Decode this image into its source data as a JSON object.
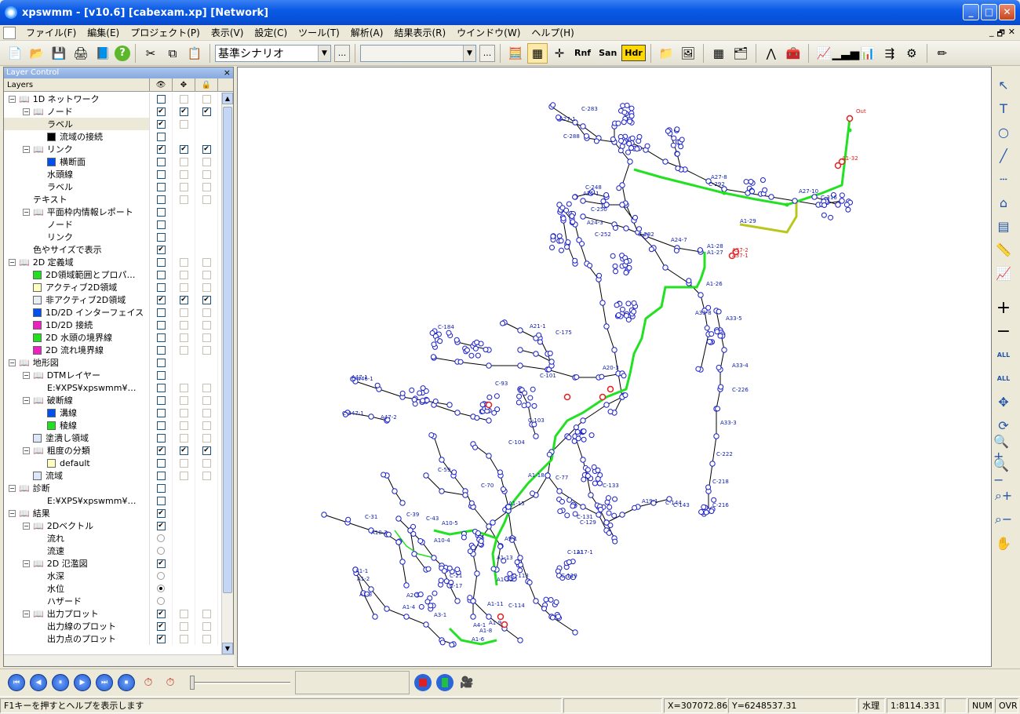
{
  "window": {
    "title": "xpswmm - [v10.6] [cabexam.xp] [Network]",
    "minimize": "_",
    "maximize": "□",
    "close": "✕"
  },
  "menu": [
    "ファイル(F)",
    "編集(E)",
    "プロジェクト(P)",
    "表示(V)",
    "設定(C)",
    "ツール(T)",
    "解析(A)",
    "結果表示(R)",
    "ウインドウ(W)",
    "ヘルプ(H)"
  ],
  "mdi_controls": [
    "_",
    "🗗",
    "✕"
  ],
  "toolbar": {
    "scenario_value": "基準シナリオ",
    "scenario_dots": "...",
    "combo2_value": "",
    "combo2_dots": "...",
    "rnf_label": "Rnf",
    "san_label": "San",
    "hdr_label": "Hdr"
  },
  "layer_panel": {
    "title": "Layer Control",
    "close": "×",
    "header_name": "Layers",
    "col_icons": [
      "👁",
      "✥",
      "🔒"
    ],
    "rows": [
      {
        "label": "1D ネットワーク",
        "level": 0,
        "exp": "−",
        "book": true,
        "c": [
          "e",
          "e",
          "e"
        ]
      },
      {
        "label": "ノード",
        "level": 1,
        "exp": "−",
        "book": true,
        "c": [
          "x",
          "x",
          "x"
        ]
      },
      {
        "label": "ラベル",
        "level": 2,
        "c": [
          "x",
          "e",
          ""
        ],
        "sel": true
      },
      {
        "label": "流域の接続",
        "level": 2,
        "sw": "#000000",
        "c": [
          "e",
          "",
          ""
        ]
      },
      {
        "label": "リンク",
        "level": 1,
        "exp": "−",
        "book": true,
        "c": [
          "x",
          "x",
          "x"
        ]
      },
      {
        "label": "横断面",
        "level": 2,
        "sw": "#0050f0",
        "c": [
          "e",
          "e",
          "e"
        ]
      },
      {
        "label": "水頭線",
        "level": 2,
        "c": [
          "e",
          "e",
          "e"
        ]
      },
      {
        "label": "ラベル",
        "level": 2,
        "c": [
          "e",
          "e",
          "e"
        ]
      },
      {
        "label": "テキスト",
        "level": 1,
        "c": [
          "e",
          "e",
          "e"
        ]
      },
      {
        "label": "平面枠内情報レポート",
        "level": 1,
        "exp": "−",
        "book": true,
        "c": [
          "e",
          "",
          ""
        ]
      },
      {
        "label": "ノード",
        "level": 2,
        "c": [
          "e",
          "",
          ""
        ]
      },
      {
        "label": "リンク",
        "level": 2,
        "c": [
          "e",
          "",
          ""
        ]
      },
      {
        "label": "色やサイズで表示",
        "level": 1,
        "c": [
          "x",
          "",
          ""
        ]
      },
      {
        "label": "2D 定義域",
        "level": 0,
        "exp": "−",
        "book": true,
        "c": [
          "e",
          "e",
          "e"
        ]
      },
      {
        "label": "2D領域範囲とプロパ…",
        "level": 1,
        "sw": "#20e020",
        "c": [
          "e",
          "e",
          "e"
        ]
      },
      {
        "label": "アクティブ2D領域",
        "level": 1,
        "sw": "#ffffc0",
        "c": [
          "e",
          "e",
          "e"
        ]
      },
      {
        "label": "非アクティブ2D領域",
        "level": 1,
        "sw": "#e8eef8",
        "c": [
          "x",
          "x",
          "x"
        ]
      },
      {
        "label": "1D/2D インターフェイス",
        "level": 1,
        "sw": "#0050f0",
        "c": [
          "e",
          "e",
          "e"
        ]
      },
      {
        "label": "1D/2D 接続",
        "level": 1,
        "sw": "#f020c0",
        "c": [
          "e",
          "e",
          "e"
        ]
      },
      {
        "label": "2D 水頭の境界線",
        "level": 1,
        "sw": "#20e020",
        "c": [
          "e",
          "e",
          "e"
        ]
      },
      {
        "label": "2D 流れ境界線",
        "level": 1,
        "sw": "#f020c0",
        "c": [
          "e",
          "e",
          "e"
        ]
      },
      {
        "label": "地形図",
        "level": 0,
        "exp": "−",
        "book": true,
        "c": [
          "e",
          "",
          ""
        ]
      },
      {
        "label": "DTMレイヤー",
        "level": 1,
        "exp": "−",
        "book": true,
        "c": [
          "e",
          "",
          ""
        ]
      },
      {
        "label": "E:¥XPS¥xpswmm¥…",
        "level": 2,
        "c": [
          "e",
          "e",
          "e"
        ]
      },
      {
        "label": "破断線",
        "level": 1,
        "exp": "−",
        "book": true,
        "c": [
          "e",
          "e",
          "e"
        ]
      },
      {
        "label": "溝線",
        "level": 2,
        "sw": "#0050f0",
        "c": [
          "e",
          "e",
          "e"
        ]
      },
      {
        "label": "稜線",
        "level": 2,
        "sw": "#20e020",
        "c": [
          "e",
          "e",
          "e"
        ]
      },
      {
        "label": "塗潰し領域",
        "level": 1,
        "sw": "#dce8f8",
        "c": [
          "e",
          "e",
          "e"
        ]
      },
      {
        "label": "粗度の分類",
        "level": 1,
        "exp": "−",
        "book": true,
        "c": [
          "x",
          "x",
          "x"
        ]
      },
      {
        "label": "default",
        "level": 2,
        "sw": "#ffffc0",
        "c": [
          "e",
          "e",
          "e"
        ]
      },
      {
        "label": "流域",
        "level": 1,
        "sw": "#dce8f8",
        "c": [
          "e",
          "e",
          "e"
        ]
      },
      {
        "label": "診断",
        "level": 0,
        "exp": "−",
        "book": true,
        "c": [
          "e",
          "",
          ""
        ]
      },
      {
        "label": "E:¥XPS¥xpswmm¥…",
        "level": 2,
        "c": [
          "e",
          "",
          ""
        ]
      },
      {
        "label": "結果",
        "level": 0,
        "exp": "−",
        "book": true,
        "c": [
          "x",
          "",
          ""
        ]
      },
      {
        "label": "2Dベクトル",
        "level": 1,
        "exp": "−",
        "book": true,
        "c": [
          "x",
          "",
          ""
        ]
      },
      {
        "label": "流れ",
        "level": 2,
        "c": [
          "r",
          "",
          ""
        ]
      },
      {
        "label": "流速",
        "level": 2,
        "c": [
          "r",
          "",
          ""
        ]
      },
      {
        "label": "2D 氾濫図",
        "level": 1,
        "exp": "−",
        "book": true,
        "c": [
          "x",
          "",
          ""
        ]
      },
      {
        "label": "水深",
        "level": 2,
        "c": [
          "r",
          "",
          ""
        ]
      },
      {
        "label": "水位",
        "level": 2,
        "c": [
          "ro",
          "",
          ""
        ]
      },
      {
        "label": "ハザード",
        "level": 2,
        "c": [
          "r",
          "",
          ""
        ]
      },
      {
        "label": "出力プロット",
        "level": 1,
        "exp": "−",
        "book": true,
        "c": [
          "x",
          "e",
          "e"
        ]
      },
      {
        "label": "出力線のプロット",
        "level": 2,
        "c": [
          "x",
          "e",
          "e"
        ]
      },
      {
        "label": "出力点のプロット",
        "level": 2,
        "c": [
          "x",
          "e",
          "e"
        ]
      }
    ]
  },
  "map": {
    "labels": [
      {
        "t": "Out",
        "red": true
      },
      {
        "t": "A27-1"
      },
      {
        "t": "C-283"
      },
      {
        "t": "C-288"
      },
      {
        "t": "A27-8"
      },
      {
        "t": "C-292"
      },
      {
        "t": "A27-10"
      },
      {
        "t": "C-316"
      },
      {
        "t": "A1-32",
        "red": true
      },
      {
        "t": "A1-29"
      },
      {
        "t": "A24-7"
      },
      {
        "t": "C-282"
      },
      {
        "t": "A1-28"
      },
      {
        "t": "A1-27"
      },
      {
        "t": "A37-2",
        "red": true
      },
      {
        "t": "A37-1",
        "red": true
      },
      {
        "t": "A1-26"
      },
      {
        "t": "A33-8"
      },
      {
        "t": "A33-5"
      },
      {
        "t": "A33-4"
      },
      {
        "t": "C-226"
      },
      {
        "t": "A33-3"
      },
      {
        "t": "C-222"
      },
      {
        "t": "C-218"
      },
      {
        "t": "C-216"
      },
      {
        "t": "C-248"
      },
      {
        "t": "A25-1"
      },
      {
        "t": "C-250"
      },
      {
        "t": "A24-3"
      },
      {
        "t": "C-252"
      },
      {
        "t": "A21-1"
      },
      {
        "t": "C-175"
      },
      {
        "t": "A20-3"
      },
      {
        "t": "C-101"
      },
      {
        "t": "C-93"
      },
      {
        "t": "C-103"
      },
      {
        "t": "A1-18"
      },
      {
        "t": "C-77"
      },
      {
        "t": "C-133"
      },
      {
        "t": "A19-1"
      },
      {
        "t": "C-144"
      },
      {
        "t": "C-143"
      },
      {
        "t": "C-131"
      },
      {
        "t": "C-129"
      },
      {
        "t": "A17-1"
      },
      {
        "t": "C-121"
      },
      {
        "t": "C-119"
      },
      {
        "t": "A1-15"
      },
      {
        "t": "A1-13"
      },
      {
        "t": "A1-12"
      },
      {
        "t": "A1-11"
      },
      {
        "t": "C-114"
      },
      {
        "t": "A1-9"
      },
      {
        "t": "A1-8"
      },
      {
        "t": "A1-6"
      },
      {
        "t": "A4-1"
      },
      {
        "t": "A3-1"
      },
      {
        "t": "A2-1"
      },
      {
        "t": "A1-4"
      },
      {
        "t": "A1-3"
      },
      {
        "t": "A1-2"
      },
      {
        "t": "A1-1"
      },
      {
        "t": "A10-2"
      },
      {
        "t": "C-31"
      },
      {
        "t": "C-39"
      },
      {
        "t": "C-43"
      },
      {
        "t": "A10-5"
      },
      {
        "t": "A10-4"
      },
      {
        "t": "A47-1"
      },
      {
        "t": "C-447-1"
      },
      {
        "t": "A47-2"
      },
      {
        "t": "C-446-1"
      },
      {
        "t": "C-184"
      },
      {
        "t": "C-104"
      },
      {
        "t": "C-70"
      },
      {
        "t": "C-59"
      },
      {
        "t": "C-21"
      },
      {
        "t": "C-17"
      },
      {
        "t": "A9-1"
      },
      {
        "t": "C-113"
      }
    ]
  },
  "right_tools": [
    "↖",
    "T",
    "○",
    "╱",
    "┄",
    "⌂",
    "▤",
    "📏",
    "📈",
    "+",
    "−",
    "ALL",
    "ALL",
    "✥",
    "⟳",
    "🔍+",
    "🔍−",
    "⌕+",
    "⌕−",
    "✋"
  ],
  "playback": {
    "buttons": [
      "⏮",
      "◀",
      "⏸",
      "▶",
      "⏭",
      "⏹"
    ]
  },
  "status": {
    "help": "F1キーを押すとヘルプを表示します",
    "x": "X=307072.86",
    "y": "Y=6248537.31",
    "mode": "水理",
    "scale": "1:8114.331",
    "num": "NUM",
    "ovr": "OVR"
  },
  "colors": {
    "node": "#1a20c8",
    "label": "#1020b0",
    "flow_path": "#22e022",
    "red_node": "#e02020",
    "link": "#000000",
    "yellow_link": "#b8c81a"
  }
}
